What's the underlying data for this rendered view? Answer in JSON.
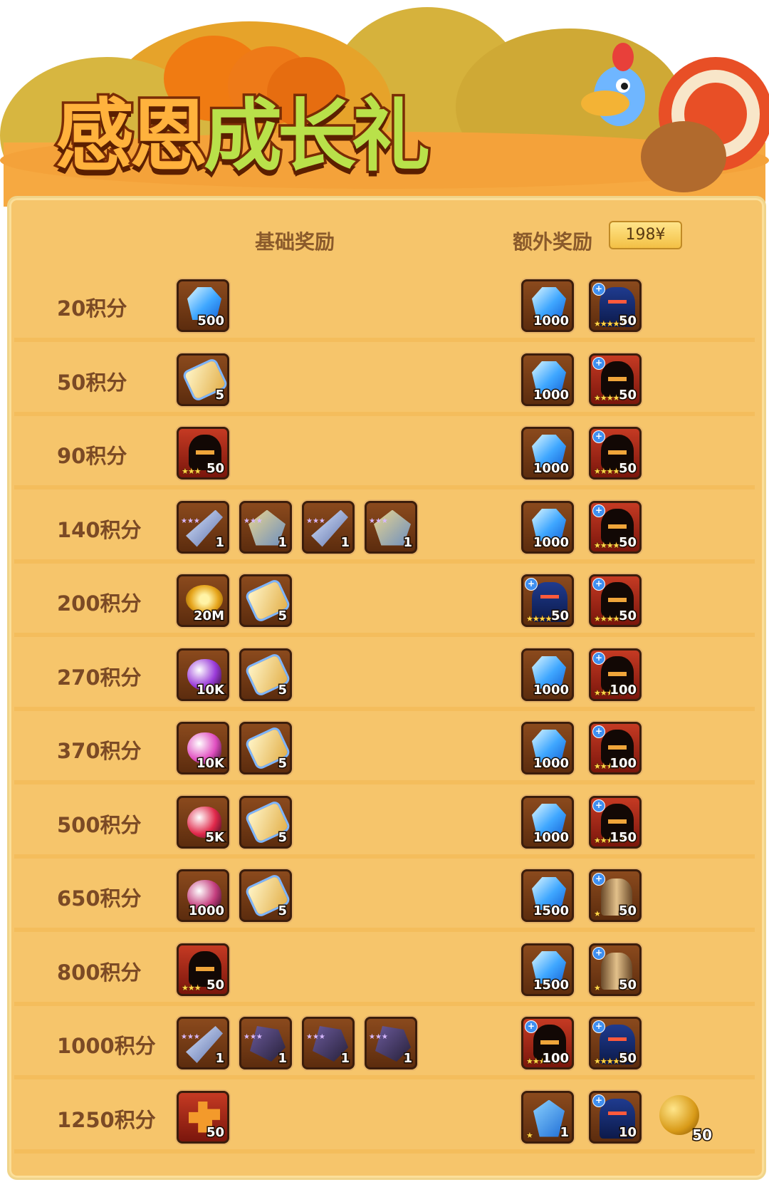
{
  "banner": {
    "title_chars": [
      "感",
      "恩",
      "成",
      "长",
      "礼"
    ],
    "colors": {
      "orange": "#ffb23d",
      "green": "#b9e14a",
      "outline": "#7a2c05"
    }
  },
  "header": {
    "base_label": "基础奖励",
    "extra_label": "额外奖励",
    "price": "198¥"
  },
  "rows": [
    {
      "label": "20积分",
      "base": [
        {
          "icon": "diamond-icon",
          "qty": "500"
        }
      ],
      "extra": [
        {
          "icon": "diamond-icon",
          "qty": "1000"
        },
        {
          "icon": "knight-hero-icon",
          "qty": "50",
          "stars": "★★★★★",
          "plus": true
        }
      ]
    },
    {
      "label": "50积分",
      "base": [
        {
          "icon": "scroll-icon",
          "qty": "5"
        }
      ],
      "extra": [
        {
          "icon": "diamond-icon",
          "qty": "1000"
        },
        {
          "icon": "dark-hero-icon",
          "qty": "50",
          "stars": "★★★★",
          "plus": true,
          "red": true
        }
      ]
    },
    {
      "label": "90积分",
      "base": [
        {
          "icon": "dark-hero-icon",
          "qty": "50",
          "stars": "★★★",
          "red": true
        }
      ],
      "extra": [
        {
          "icon": "diamond-icon",
          "qty": "1000"
        },
        {
          "icon": "dark-hero-icon",
          "qty": "50",
          "stars": "★★★★",
          "plus": true,
          "red": true
        }
      ]
    },
    {
      "label": "140积分",
      "base": [
        {
          "icon": "crossbow-icon",
          "qty": "1",
          "pstars": "★★★"
        },
        {
          "icon": "armor-icon",
          "qty": "1",
          "pstars": "★★★"
        },
        {
          "icon": "sword-icon",
          "qty": "1",
          "pstars": "★★★"
        },
        {
          "icon": "boots-icon",
          "qty": "1",
          "pstars": "★★★"
        }
      ],
      "extra": [
        {
          "icon": "diamond-icon",
          "qty": "1000"
        },
        {
          "icon": "dark-hero-icon",
          "qty": "50",
          "stars": "★★★★",
          "plus": true,
          "red": true
        }
      ]
    },
    {
      "label": "200积分",
      "base": [
        {
          "icon": "gold-coin-icon",
          "qty": "20M"
        },
        {
          "icon": "scroll-icon",
          "qty": "5"
        }
      ],
      "extra": [
        {
          "icon": "knight-hero-icon",
          "qty": "50",
          "stars": "★★★★",
          "plus": true
        },
        {
          "icon": "dark-hero-icon",
          "qty": "50",
          "stars": "★★★★",
          "plus": true,
          "red": true
        }
      ]
    },
    {
      "label": "270积分",
      "base": [
        {
          "icon": "purple-potion-icon",
          "qty": "10K",
          "color": "#9a3bd9"
        },
        {
          "icon": "scroll-icon",
          "qty": "5"
        }
      ],
      "extra": [
        {
          "icon": "diamond-icon",
          "qty": "1000"
        },
        {
          "icon": "dark-hero-icon",
          "qty": "100",
          "stars": "★★★★★",
          "plus": true,
          "red": true
        }
      ]
    },
    {
      "label": "370积分",
      "base": [
        {
          "icon": "pink-crystal-icon",
          "qty": "10K",
          "color": "#e04fc0"
        },
        {
          "icon": "scroll-icon",
          "qty": "5"
        }
      ],
      "extra": [
        {
          "icon": "diamond-icon",
          "qty": "1000"
        },
        {
          "icon": "dark-hero-icon",
          "qty": "100",
          "stars": "★★★★★",
          "plus": true,
          "red": true
        }
      ]
    },
    {
      "label": "500积分",
      "base": [
        {
          "icon": "red-gem-icon",
          "qty": "5K",
          "color": "#e0284a"
        },
        {
          "icon": "scroll-icon",
          "qty": "5"
        }
      ],
      "extra": [
        {
          "icon": "diamond-icon",
          "qty": "1000"
        },
        {
          "icon": "dark-hero-icon",
          "qty": "150",
          "stars": "★★★★★",
          "plus": true,
          "red": true
        }
      ]
    },
    {
      "label": "650积分",
      "base": [
        {
          "icon": "ore-icon",
          "qty": "1000",
          "color": "#c43e7e"
        },
        {
          "icon": "scroll-icon",
          "qty": "5"
        }
      ],
      "extra": [
        {
          "icon": "diamond-icon",
          "qty": "1500"
        },
        {
          "icon": "log-hero-icon",
          "qty": "50",
          "stars": "★",
          "plus": true
        }
      ]
    },
    {
      "label": "800积分",
      "base": [
        {
          "icon": "fire-hero-icon",
          "qty": "50",
          "stars": "★★★",
          "red": true
        }
      ],
      "extra": [
        {
          "icon": "diamond-icon",
          "qty": "1500"
        },
        {
          "icon": "log-hero-icon",
          "qty": "50",
          "stars": "★",
          "plus": true
        }
      ]
    },
    {
      "label": "1000积分",
      "base": [
        {
          "icon": "blade-icon",
          "qty": "1",
          "pstars": "★★★"
        },
        {
          "icon": "dark-gauntlet-icon",
          "qty": "1",
          "pstars": "★★★"
        },
        {
          "icon": "dark-armor-icon",
          "qty": "1",
          "pstars": "★★★"
        },
        {
          "icon": "dark-helm-icon",
          "qty": "1",
          "pstars": "★★★"
        }
      ],
      "extra": [
        {
          "icon": "dark-hero-icon",
          "qty": "100",
          "stars": "★★★★★",
          "plus": true,
          "red": true
        },
        {
          "icon": "knight-hero-icon",
          "qty": "50",
          "stars": "★★★★★",
          "plus": true
        }
      ]
    },
    {
      "label": "1250积分",
      "base": [
        {
          "icon": "puzzle-piece-icon",
          "qty": "50",
          "red": true
        }
      ],
      "extra": [
        {
          "icon": "emblem-icon",
          "qty": "1",
          "stars": "★"
        },
        {
          "icon": "paladin-hero-icon",
          "qty": "10",
          "plus": true
        },
        {
          "icon": "gold-bag-icon",
          "qty": "50",
          "bare": true
        }
      ]
    }
  ]
}
